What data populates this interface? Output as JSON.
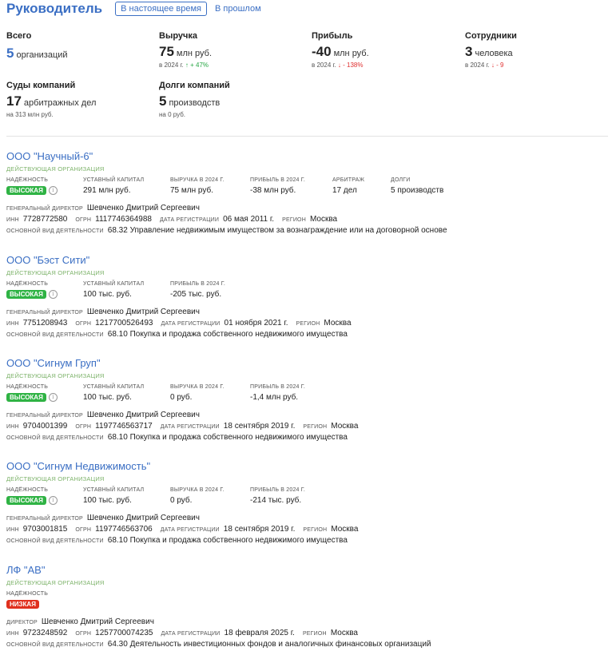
{
  "header": {
    "title": "Руководитель",
    "tab_current": "В настоящее время",
    "tab_past": "В прошлом"
  },
  "stats": {
    "total": {
      "label": "Всего",
      "num": "5",
      "unit": "организаций"
    },
    "revenue": {
      "label": "Выручка",
      "num": "75",
      "unit": "млн руб.",
      "sub_prefix": "в 2024 г.",
      "trend": "↑ + 47%"
    },
    "profit": {
      "label": "Прибыль",
      "num": "-40",
      "unit": "млн руб.",
      "sub_prefix": "в 2024 г.",
      "trend": "↓ - 138%"
    },
    "employees": {
      "label": "Сотрудники",
      "num": "3",
      "unit": "человека",
      "sub_prefix": "в 2024 г.",
      "trend": "↓ - 9"
    },
    "courts": {
      "label": "Суды компаний",
      "num": "17",
      "unit": "арбитражных дел",
      "sub": "на 313 млн руб."
    },
    "debts": {
      "label": "Долги компаний",
      "num": "5",
      "unit": "производств",
      "sub": "на 0 руб."
    }
  },
  "labels": {
    "status_active": "ДЕЙСТВУЮЩАЯ ОРГАНИЗАЦИЯ",
    "reliability": "НАДЁЖНОСТЬ",
    "capital": "УСТАВНЫЙ КАПИТАЛ",
    "revenue_2024": "ВЫРУЧКА В 2024 Г.",
    "profit_2024": "ПРИБЫЛЬ В 2024 Г.",
    "arbitration": "АРБИТРАЖ",
    "debts": "ДОЛГИ",
    "general_director": "ГЕНЕРАЛЬНЫЙ ДИРЕКТОР",
    "director": "ДИРЕКТОР",
    "inn": "ИНН",
    "ogrn": "ОГРН",
    "reg_date": "ДАТА РЕГИСТРАЦИИ",
    "region": "РЕГИОН",
    "activity": "ОСНОВНОЙ ВИД ДЕЯТЕЛЬНОСТИ"
  },
  "orgs": [
    {
      "name": "ООО \"Научный-6\"",
      "reliability": "ВЫСОКАЯ",
      "capital": "291 млн руб.",
      "revenue": "75 млн руб.",
      "profit": "-38 млн руб.",
      "arbitration": "17 дел",
      "debts": "5 производств",
      "director": "Шевченко Дмитрий Сергеевич",
      "inn": "7728772580",
      "ogrn": "1117746364988",
      "reg_date": "06 мая 2011 г.",
      "region": "Москва",
      "activity": "68.32 Управление недвижимым имуществом за вознаграждение или на договорной основе"
    },
    {
      "name": "ООО \"Бэст Сити\"",
      "reliability": "ВЫСОКАЯ",
      "capital": "100 тыс. руб.",
      "profit": "-205 тыс. руб.",
      "director": "Шевченко Дмитрий Сергеевич",
      "inn": "7751208943",
      "ogrn": "1217700526493",
      "reg_date": "01 ноября 2021 г.",
      "region": "Москва",
      "activity": "68.10 Покупка и продажа собственного недвижимого имущества"
    },
    {
      "name": "ООО \"Сигнум Груп\"",
      "reliability": "ВЫСОКАЯ",
      "capital": "100 тыс. руб.",
      "revenue": "0 руб.",
      "profit": "-1,4 млн руб.",
      "director": "Шевченко Дмитрий Сергеевич",
      "inn": "9704001399",
      "ogrn": "1197746563717",
      "reg_date": "18 сентября 2019 г.",
      "region": "Москва",
      "activity": "68.10 Покупка и продажа собственного недвижимого имущества"
    },
    {
      "name": "ООО \"Сигнум Недвижимость\"",
      "reliability": "ВЫСОКАЯ",
      "capital": "100 тыс. руб.",
      "revenue": "0 руб.",
      "profit": "-214 тыс. руб.",
      "director": "Шевченко Дмитрий Сергеевич",
      "inn": "9703001815",
      "ogrn": "1197746563706",
      "reg_date": "18 сентября 2019 г.",
      "region": "Москва",
      "activity": "68.10 Покупка и продажа собственного недвижимого имущества"
    },
    {
      "name": "ЛФ \"АВ\"",
      "reliability": "НИЗКАЯ",
      "director": "Шевченко Дмитрий Сергеевич",
      "inn": "9723248592",
      "ogrn": "1257700074235",
      "reg_date": "18 февраля 2025 г.",
      "region": "Москва",
      "activity": "64.30 Деятельность инвестиционных фондов и аналогичных финансовых организаций"
    }
  ],
  "colors": {
    "accent": "#3b6fc4",
    "badge_high": "#2fb344",
    "badge_low": "#e0301e",
    "status": "#7db36a"
  },
  "icons": {
    "info": "info-icon"
  }
}
